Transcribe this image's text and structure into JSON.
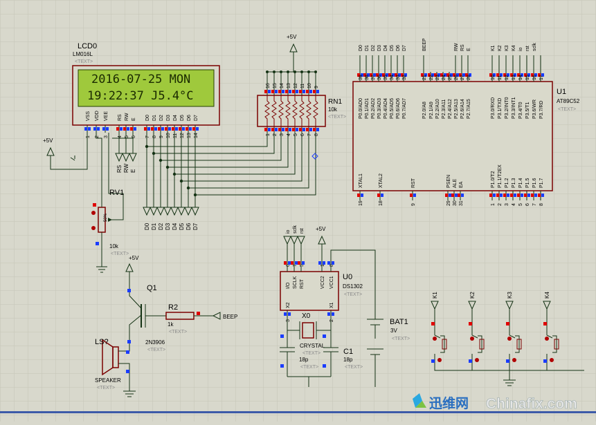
{
  "colors": {
    "background": "#d8d8cc",
    "grid": "#c4c4b6",
    "wire": "#143214",
    "body": "#7a0000",
    "lcd_screen": "#9fc93c",
    "lcd_text": "#1a2a00",
    "pin_red": "#e00000",
    "pin_blue": "#1a3cff"
  },
  "lcd": {
    "ref": "LCD0",
    "part": "LM016L",
    "text_tag": "<TEXT>",
    "line1": "2016-07-25 MON",
    "line2": "19:22:37  J5.4°C",
    "pin_names": [
      "VSS",
      "VDD",
      "VEE",
      "RS",
      "RW",
      "E",
      "D0",
      "D1",
      "D2",
      "D3",
      "D4",
      "D5",
      "D6",
      "D7"
    ],
    "pin_numbers": [
      "1",
      "2",
      "3",
      "4",
      "5",
      "6",
      "7",
      "8",
      "9",
      "10",
      "11",
      "12",
      "13",
      "14"
    ]
  },
  "u1": {
    "ref": "U1",
    "part": "AT89C52",
    "text_tag": "<TEXT>",
    "top_labels": [
      "D0",
      "D1",
      "D2",
      "D3",
      "D4",
      "D5",
      "D6",
      "D7",
      "BEEP",
      "RW",
      "RS",
      "E",
      "K1",
      "K2",
      "K3",
      "K4",
      "io",
      "rst",
      "sclk"
    ],
    "p0_pins": [
      "P0.0/AD0",
      "P0.1/AD1",
      "P0.2/AD2",
      "P0.3/AD3",
      "P0.4/AD4",
      "P0.5/AD5",
      "P0.6/AD6",
      "P0.7/AD7"
    ],
    "p0_numbers": [
      "39",
      "38",
      "37",
      "36",
      "35",
      "34",
      "33",
      "32"
    ],
    "p2_pins": [
      "P2.0/A8",
      "P2.1/A9",
      "P2.2/A10",
      "P2.3/A11",
      "P2.4/A12",
      "P2.5/A13",
      "P2.6/A14",
      "P2.7/A15"
    ],
    "p2_numbers": [
      "21",
      "22",
      "23",
      "24",
      "25",
      "26",
      "27",
      "28"
    ],
    "p3_pins": [
      "P3.0/RXD",
      "P3.1/TXD",
      "P3.2/INT0",
      "P3.3/INT1",
      "P3.4/T0",
      "P3.5/T1",
      "P3.6/WR",
      "P3.7/RD"
    ],
    "p3_numbers": [
      "10",
      "11",
      "12",
      "13",
      "14",
      "15",
      "16",
      "17"
    ],
    "left_bottom": [
      "XTAL1",
      "XTAL2",
      "RST",
      "PSEN",
      "ALE",
      "EA"
    ],
    "left_bottom_numbers": [
      "19",
      "18",
      "9",
      "29",
      "30",
      "31"
    ],
    "p1_pins": [
      "P1.0/T2",
      "P1.1/T2EX",
      "P1.2",
      "P1.3",
      "P1.4",
      "P1.5",
      "P1.6",
      "P1.7"
    ],
    "p1_numbers": [
      "1",
      "2",
      "3",
      "4",
      "5",
      "6",
      "7",
      "8"
    ]
  },
  "rn1": {
    "ref": "RN1",
    "value": "10k",
    "text_tag": "<TEXT>",
    "top_numbers": [
      "16",
      "15",
      "14",
      "13",
      "12",
      "11",
      "10",
      "9"
    ],
    "bottom_numbers": [
      "1",
      "2",
      "3",
      "4",
      "5",
      "6",
      "7",
      "8"
    ]
  },
  "rv1": {
    "ref": "RV1",
    "value": "10k",
    "text_tag": "<TEXT>",
    "percent": "50%"
  },
  "q1": {
    "ref": "Q1",
    "part": "2N3906",
    "text_tag": "<TEXT>"
  },
  "r2": {
    "ref": "R2",
    "value": "1k",
    "text_tag": "<TEXT>",
    "net": "BEEP"
  },
  "speaker": {
    "ref": "LS?",
    "part": "SPEAKER",
    "text_tag": "<TEXT>"
  },
  "u0": {
    "ref": "U0",
    "part": "DS1302",
    "text_tag": "<TEXT>",
    "pins": [
      "I/O",
      "SCLK",
      "RST",
      "VCC2",
      "VCC1",
      "X2",
      "X1"
    ],
    "pin_numbers": [
      "6",
      "7",
      "5",
      "1",
      "8",
      "3",
      "2"
    ],
    "top_nets": [
      "io",
      "sclk",
      "rst"
    ]
  },
  "x0": {
    "ref": "X0",
    "part": "CRYSTAL",
    "text_tag": "<TEXT>"
  },
  "c0": {
    "value": "18p",
    "text_tag": "<TEXT>"
  },
  "c1": {
    "ref": "C1",
    "value": "18p",
    "text_tag": "<TEXT>"
  },
  "bat1": {
    "ref": "BAT1",
    "value": "3V",
    "text_tag": "<TEXT>"
  },
  "keys": [
    "K1",
    "K2",
    "K3",
    "K4"
  ],
  "power": {
    "vcc_label": "+5V"
  },
  "lcd_ctrl_nets": [
    "RS",
    "RW",
    "E"
  ],
  "lcd_data_nets": [
    "D0",
    "D1",
    "D2",
    "D3",
    "D4",
    "D5",
    "D6",
    "D7"
  ],
  "watermark": {
    "cn": "迅维网",
    "en": "Chinafix.com"
  }
}
